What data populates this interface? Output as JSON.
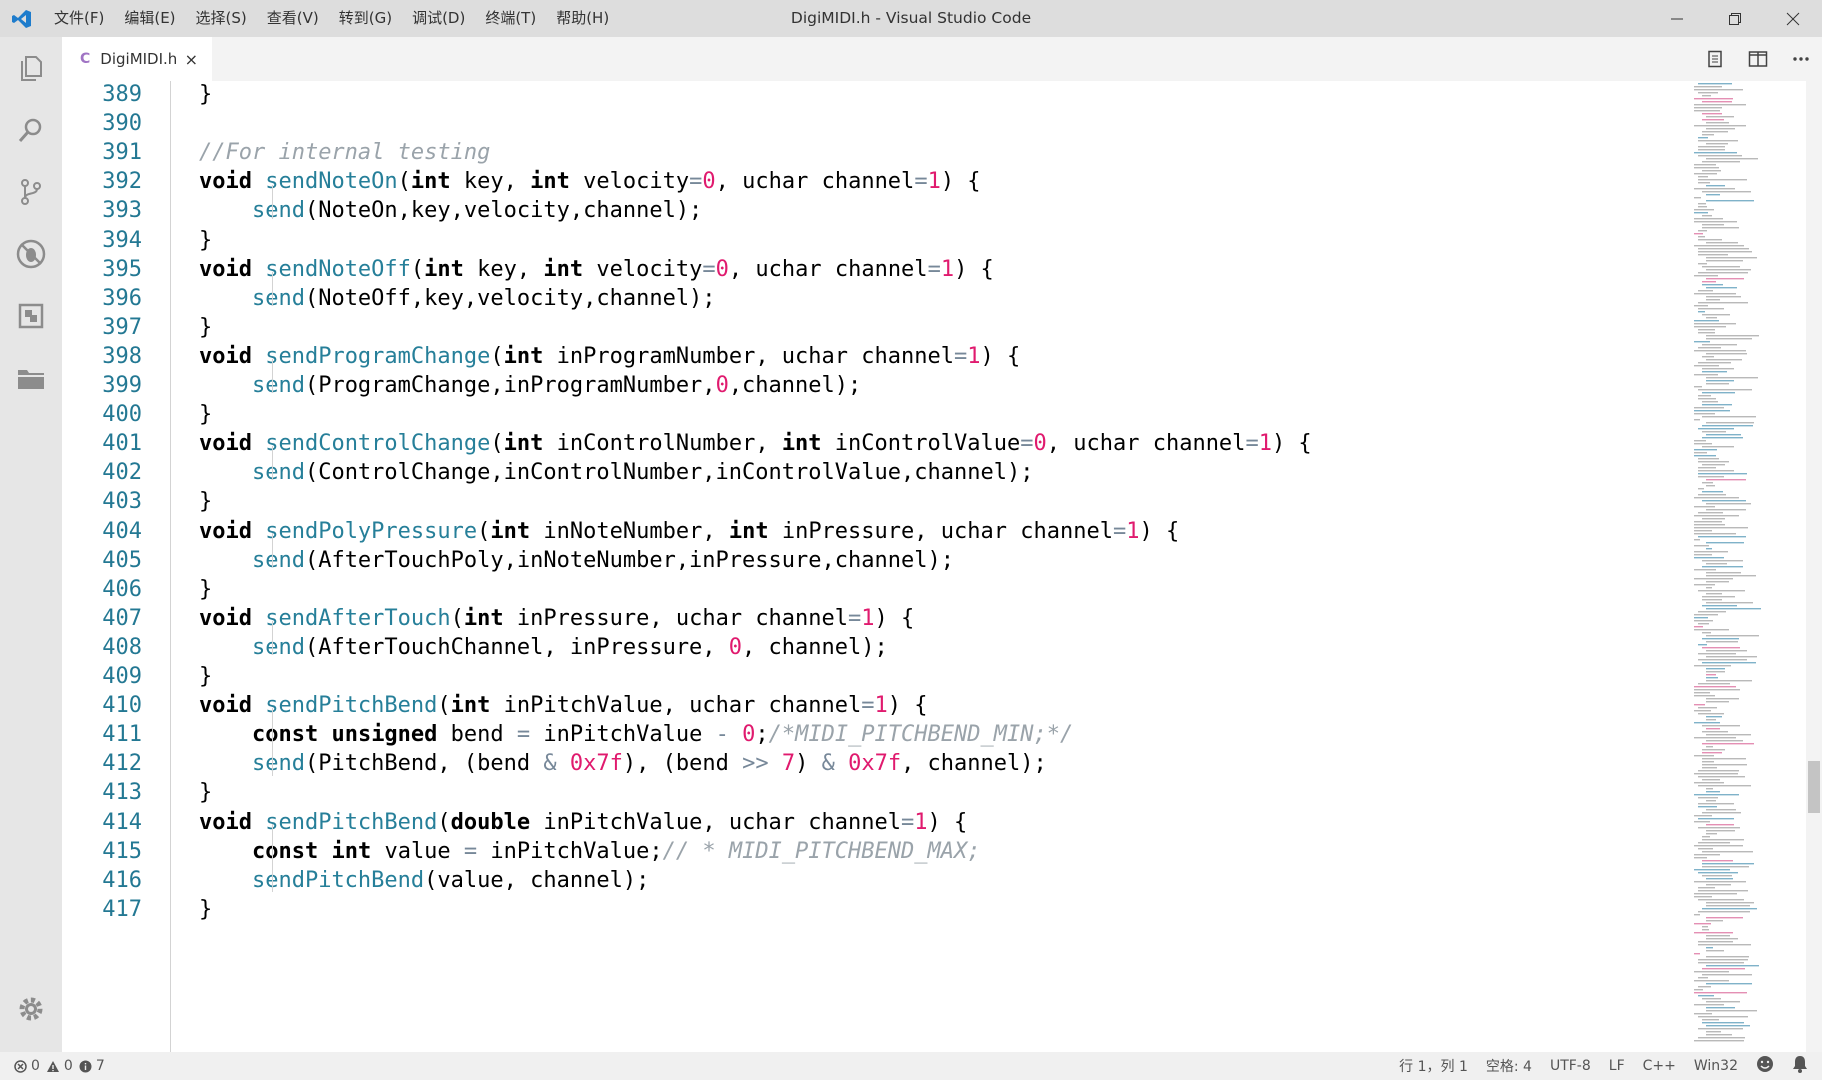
{
  "window": {
    "title": "DigiMIDI.h - Visual Studio Code"
  },
  "menu": [
    "文件(F)",
    "编辑(E)",
    "选择(S)",
    "查看(V)",
    "转到(G)",
    "调试(D)",
    "终端(T)",
    "帮助(H)"
  ],
  "tab": {
    "lang_badge": "C",
    "filename": "DigiMIDI.h",
    "close": "×"
  },
  "editor": {
    "line_numbers": [
      "389",
      "390",
      "391",
      "392",
      "393",
      "394",
      "395",
      "396",
      "397",
      "398",
      "399",
      "400",
      "401",
      "402",
      "403",
      "404",
      "405",
      "406",
      "407",
      "408",
      "409",
      "410",
      "411",
      "412",
      "413",
      "414",
      "415",
      "416",
      "417"
    ]
  },
  "status": {
    "errors": "0",
    "warnings": "0",
    "infos": "7",
    "position": "行 1，列 1",
    "spaces": "空格: 4",
    "encoding": "UTF-8",
    "eol": "LF",
    "language": "C++",
    "platform": "Win32"
  },
  "colors": {
    "keyword": "#000000",
    "function": "#267f99",
    "number": "#e01a6e",
    "comment": "#9aa3aa",
    "line_number": "#237893"
  }
}
